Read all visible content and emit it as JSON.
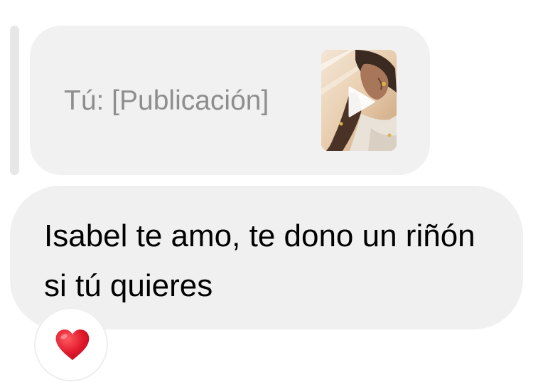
{
  "reply": {
    "label": "Tú: [Publicación]",
    "thumbnail_icon": "post-video-thumbnail",
    "play_icon": "play-icon"
  },
  "message": {
    "text": "Isabel te amo, te dono un riñón si tú quieres"
  },
  "reaction": {
    "icon": "heart-icon",
    "color": "#e0182b"
  },
  "colors": {
    "bubble": "#f0f0f0",
    "reply_text": "#8e8e8e",
    "message_text": "#000000"
  }
}
